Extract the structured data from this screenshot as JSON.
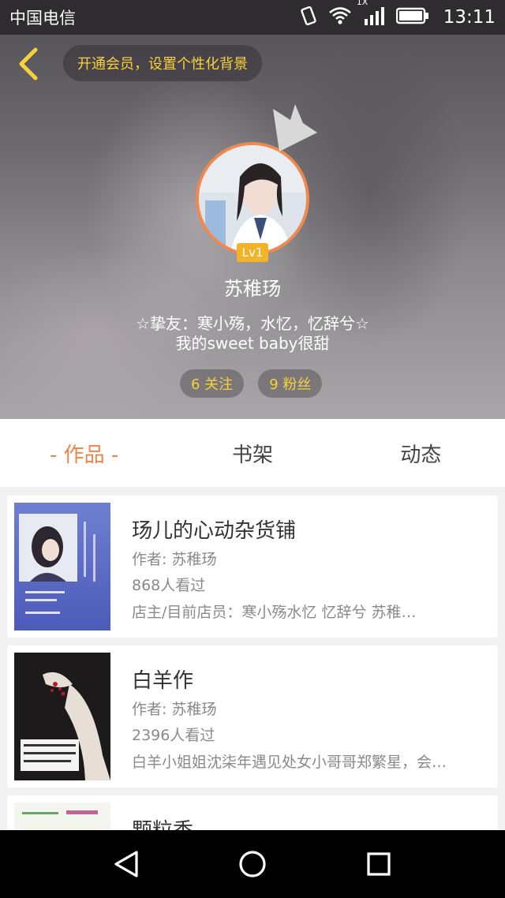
{
  "status": {
    "carrier": "中国电信",
    "network": "1X",
    "time": "13:11"
  },
  "header": {
    "vip_label": "开通会员，设置个性化背景"
  },
  "profile": {
    "level": "Lv1",
    "name": "苏稚玚",
    "bio_line1": "☆挚友：寒小殇，水忆，忆辞兮☆",
    "bio_line2": "我的sweet baby很甜",
    "following": "6 关注",
    "followers": "9 粉丝"
  },
  "tabs": [
    {
      "label": "- 作品 -",
      "active": true
    },
    {
      "label": "书架",
      "active": false
    },
    {
      "label": "动态",
      "active": false
    }
  ],
  "works": [
    {
      "title": "玚儿的心动杂货铺",
      "author": "作者: 苏稚玚",
      "views": "868人看过",
      "desc": "店主/目前店员：寒小殇水忆 忆辞兮 苏稚…"
    },
    {
      "title": "白羊作",
      "author": "作者: 苏稚玚",
      "views": "2396人看过",
      "desc": "白羊小姐姐沈柒年遇见处女小哥哥郑繁星，会…"
    },
    {
      "title": "颗粒香",
      "author": "",
      "views": "",
      "desc": ""
    }
  ],
  "colors": {
    "accent": "#ef8446",
    "gold": "#f6d23a",
    "level": "#f1b327"
  }
}
